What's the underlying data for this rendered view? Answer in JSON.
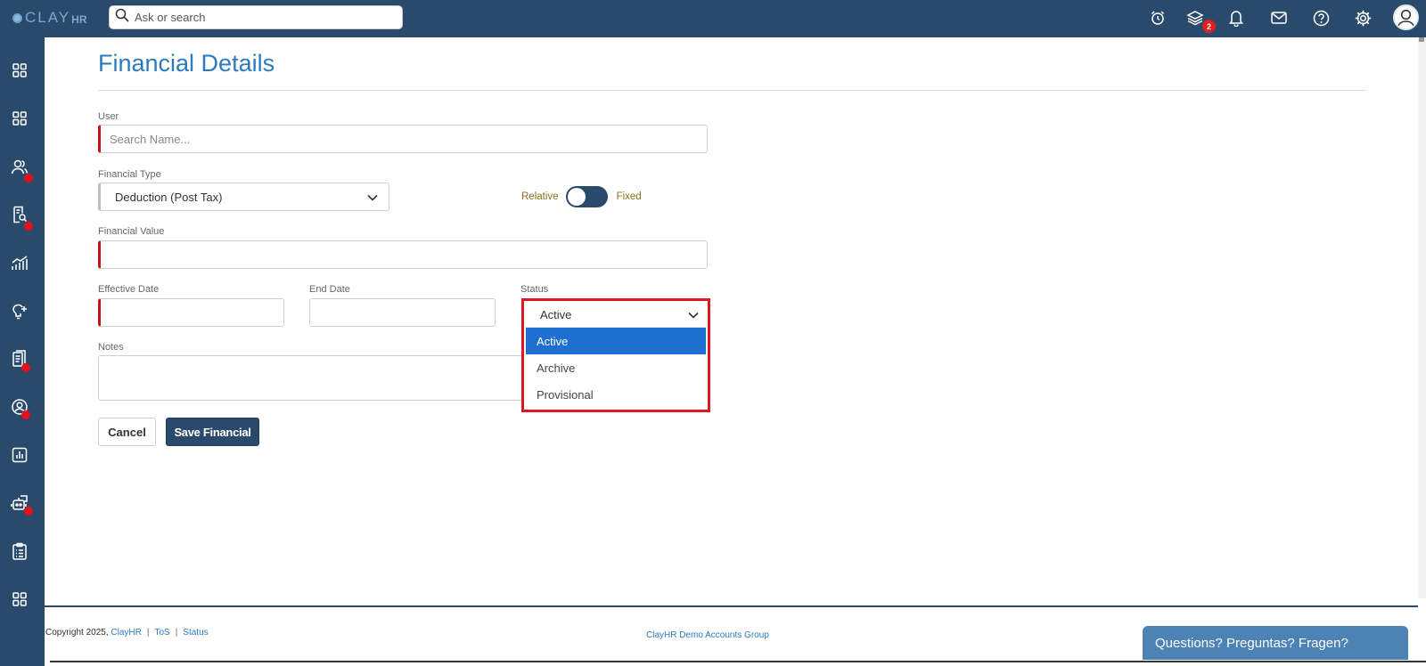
{
  "app": {
    "logo_text": "CLAY",
    "logo_suffix": "HR"
  },
  "topbar": {
    "search_placeholder": "Ask or search",
    "icons": [
      "alarm-clock-icon",
      "layers-icon",
      "bell-icon",
      "mail-icon",
      "help-icon",
      "gear-icon",
      "user-avatar-icon"
    ],
    "layers_badge": "2"
  },
  "sidebar": {
    "items": [
      {
        "icon": "grid-icon",
        "dot": false
      },
      {
        "icon": "grid-icon",
        "dot": false
      },
      {
        "icon": "users-icon",
        "dot": true
      },
      {
        "icon": "document-search-icon",
        "dot": true
      },
      {
        "icon": "chart-trend-icon",
        "dot": false
      },
      {
        "icon": "lightbulb-icon",
        "dot": false
      },
      {
        "icon": "documents-icon",
        "dot": true
      },
      {
        "icon": "user-circle-icon",
        "dot": true
      },
      {
        "icon": "bar-report-icon",
        "dot": false
      },
      {
        "icon": "robot-icon",
        "dot": true
      },
      {
        "icon": "clipboard-icon",
        "dot": false
      },
      {
        "icon": "grid-icon",
        "dot": false
      }
    ]
  },
  "page": {
    "title": "Financial Details"
  },
  "form": {
    "user": {
      "label": "User",
      "placeholder": "Search Name..."
    },
    "financial_type": {
      "label": "Financial Type",
      "value": "Deduction (Post Tax)"
    },
    "toggle": {
      "left_label": "Relative",
      "right_label": "Fixed"
    },
    "financial_value": {
      "label": "Financial Value",
      "value": ""
    },
    "effective_date": {
      "label": "Effective Date",
      "value": ""
    },
    "end_date": {
      "label": "End Date",
      "value": ""
    },
    "status": {
      "label": "Status",
      "value": "Active",
      "options": [
        "Active",
        "Archive",
        "Provisional"
      ],
      "highlighted": "Active"
    },
    "notes": {
      "label": "Notes",
      "value": ""
    },
    "cancel_label": "Cancel",
    "save_label": "Save Financial"
  },
  "footer": {
    "copyright": "Copyright 2025,",
    "company_link": "ClayHR",
    "tos_link": "ToS",
    "status_link": "Status",
    "center_text": "ClayHR Demo Accounts Group",
    "chat_label": "Questions? Preguntas? Fragen?"
  },
  "colors": {
    "brand_navy": "#2a4a6b",
    "title_blue": "#2c7bbf",
    "required_red": "#c8131b",
    "highlight_border": "#e01622",
    "selected_option": "#1f6fd1",
    "badge_red": "#e02020"
  }
}
